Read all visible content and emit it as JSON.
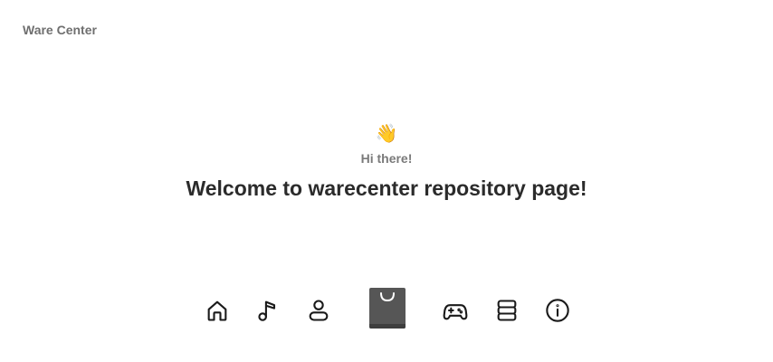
{
  "header": {
    "brand": "Ware Center"
  },
  "hero": {
    "emoji": "👋",
    "greeting": "Hi there!",
    "welcome": "Welcome to warecenter repository page!"
  },
  "dock": {
    "items": [
      {
        "name": "home",
        "icon": "home-icon"
      },
      {
        "name": "music",
        "icon": "music-note-icon"
      },
      {
        "name": "account",
        "icon": "user-icon"
      },
      {
        "name": "store",
        "icon": "shopping-bag-icon",
        "active": true
      },
      {
        "name": "games",
        "icon": "gamepad-icon"
      },
      {
        "name": "repositories",
        "icon": "stack-icon"
      },
      {
        "name": "about",
        "icon": "info-icon"
      }
    ]
  }
}
